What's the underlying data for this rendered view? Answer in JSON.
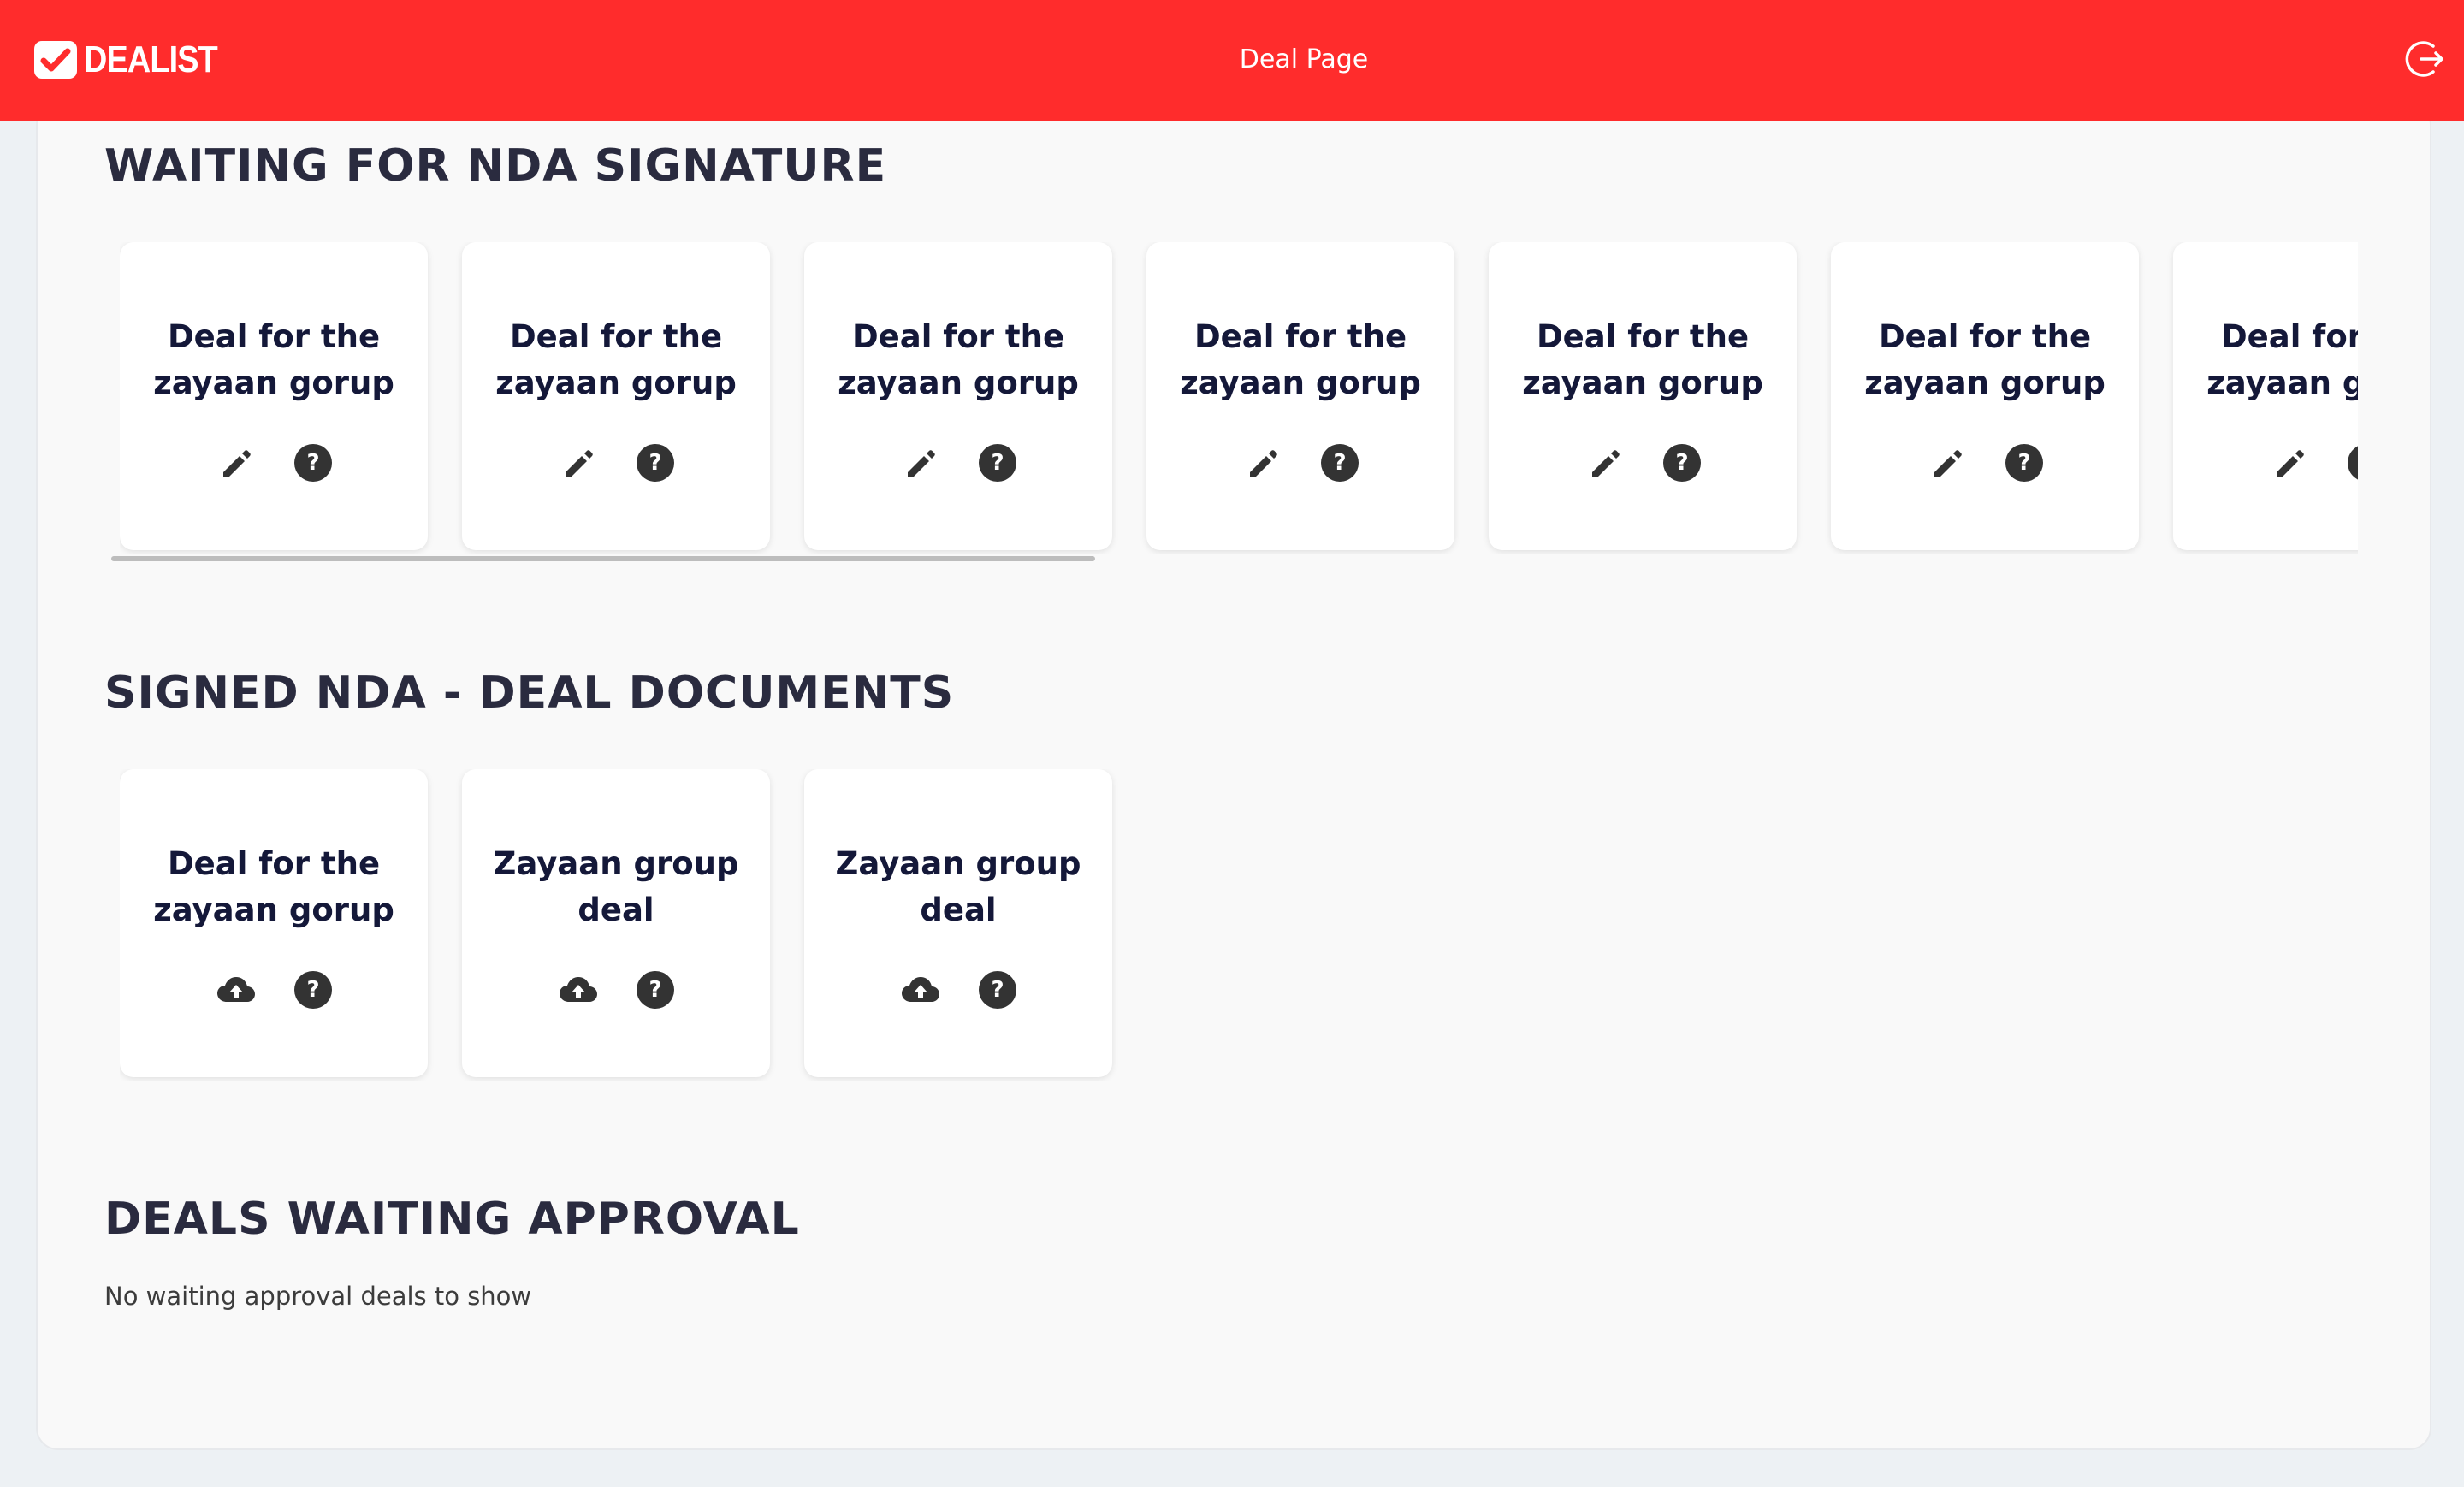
{
  "header": {
    "logo_text": "DEALIST",
    "title": "Deal Page",
    "logout_icon": "logout-icon"
  },
  "colors": {
    "brand": "#ff2c2c",
    "heading": "#2a2b3f",
    "card_title": "#141839",
    "icon": "#333333"
  },
  "sections": [
    {
      "title": "WAITING FOR NDA SIGNATURE",
      "cards": [
        {
          "title": "Deal for the zayaan gorup",
          "actions": [
            "edit-icon",
            "help-icon"
          ]
        },
        {
          "title": "Deal for the zayaan gorup",
          "actions": [
            "edit-icon",
            "help-icon"
          ]
        },
        {
          "title": "Deal for the zayaan gorup",
          "actions": [
            "edit-icon",
            "help-icon"
          ]
        },
        {
          "title": "Deal for the zayaan gorup",
          "actions": [
            "edit-icon",
            "help-icon"
          ]
        },
        {
          "title": "Deal for the zayaan gorup",
          "actions": [
            "edit-icon",
            "help-icon"
          ]
        },
        {
          "title": "Deal for the zayaan gorup",
          "actions": [
            "edit-icon",
            "help-icon"
          ]
        },
        {
          "title": "Deal for the zayaan gorup",
          "actions": [
            "edit-icon",
            "help-icon"
          ]
        }
      ]
    },
    {
      "title": "SIGNED NDA - DEAL DOCUMENTS",
      "cards": [
        {
          "title": "Deal for the zayaan gorup",
          "actions": [
            "upload-cloud-icon",
            "help-icon"
          ]
        },
        {
          "title": "Zayaan group deal",
          "actions": [
            "upload-cloud-icon",
            "help-icon"
          ]
        },
        {
          "title": "Zayaan group deal",
          "actions": [
            "upload-cloud-icon",
            "help-icon"
          ]
        }
      ]
    },
    {
      "title": "DEALS WAITING APPROVAL",
      "empty_message": "No waiting approval deals to show"
    }
  ]
}
